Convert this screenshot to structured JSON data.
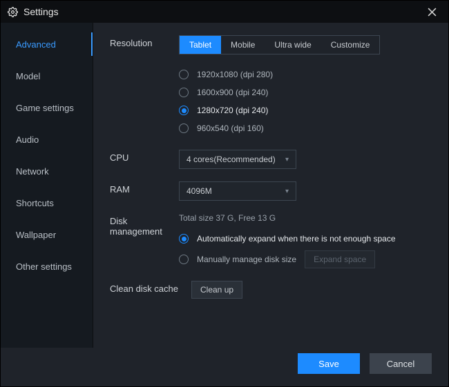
{
  "title": "Settings",
  "sidebar": {
    "items": [
      {
        "label": "Advanced",
        "active": true
      },
      {
        "label": "Model"
      },
      {
        "label": "Game settings"
      },
      {
        "label": "Audio"
      },
      {
        "label": "Network"
      },
      {
        "label": "Shortcuts"
      },
      {
        "label": "Wallpaper"
      },
      {
        "label": "Other settings"
      }
    ]
  },
  "resolution": {
    "label": "Resolution",
    "tabs": [
      {
        "label": "Tablet",
        "active": true
      },
      {
        "label": "Mobile"
      },
      {
        "label": "Ultra wide"
      },
      {
        "label": "Customize"
      }
    ],
    "options": [
      {
        "label": "1920x1080  (dpi 280)"
      },
      {
        "label": "1600x900  (dpi 240)"
      },
      {
        "label": "1280x720  (dpi 240)",
        "selected": true
      },
      {
        "label": "960x540  (dpi 160)"
      }
    ]
  },
  "cpu": {
    "label": "CPU",
    "value": "4 cores(Recommended)"
  },
  "ram": {
    "label": "RAM",
    "value": "4096M"
  },
  "disk": {
    "label": "Disk management",
    "info": "Total size 37 G,  Free 13 G",
    "options": [
      {
        "label": "Automatically expand when there is not enough space",
        "selected": true
      },
      {
        "label": "Manually manage disk size"
      }
    ],
    "expand_label": "Expand space"
  },
  "clean": {
    "label": "Clean disk cache",
    "button": "Clean up"
  },
  "footer": {
    "save": "Save",
    "cancel": "Cancel"
  }
}
